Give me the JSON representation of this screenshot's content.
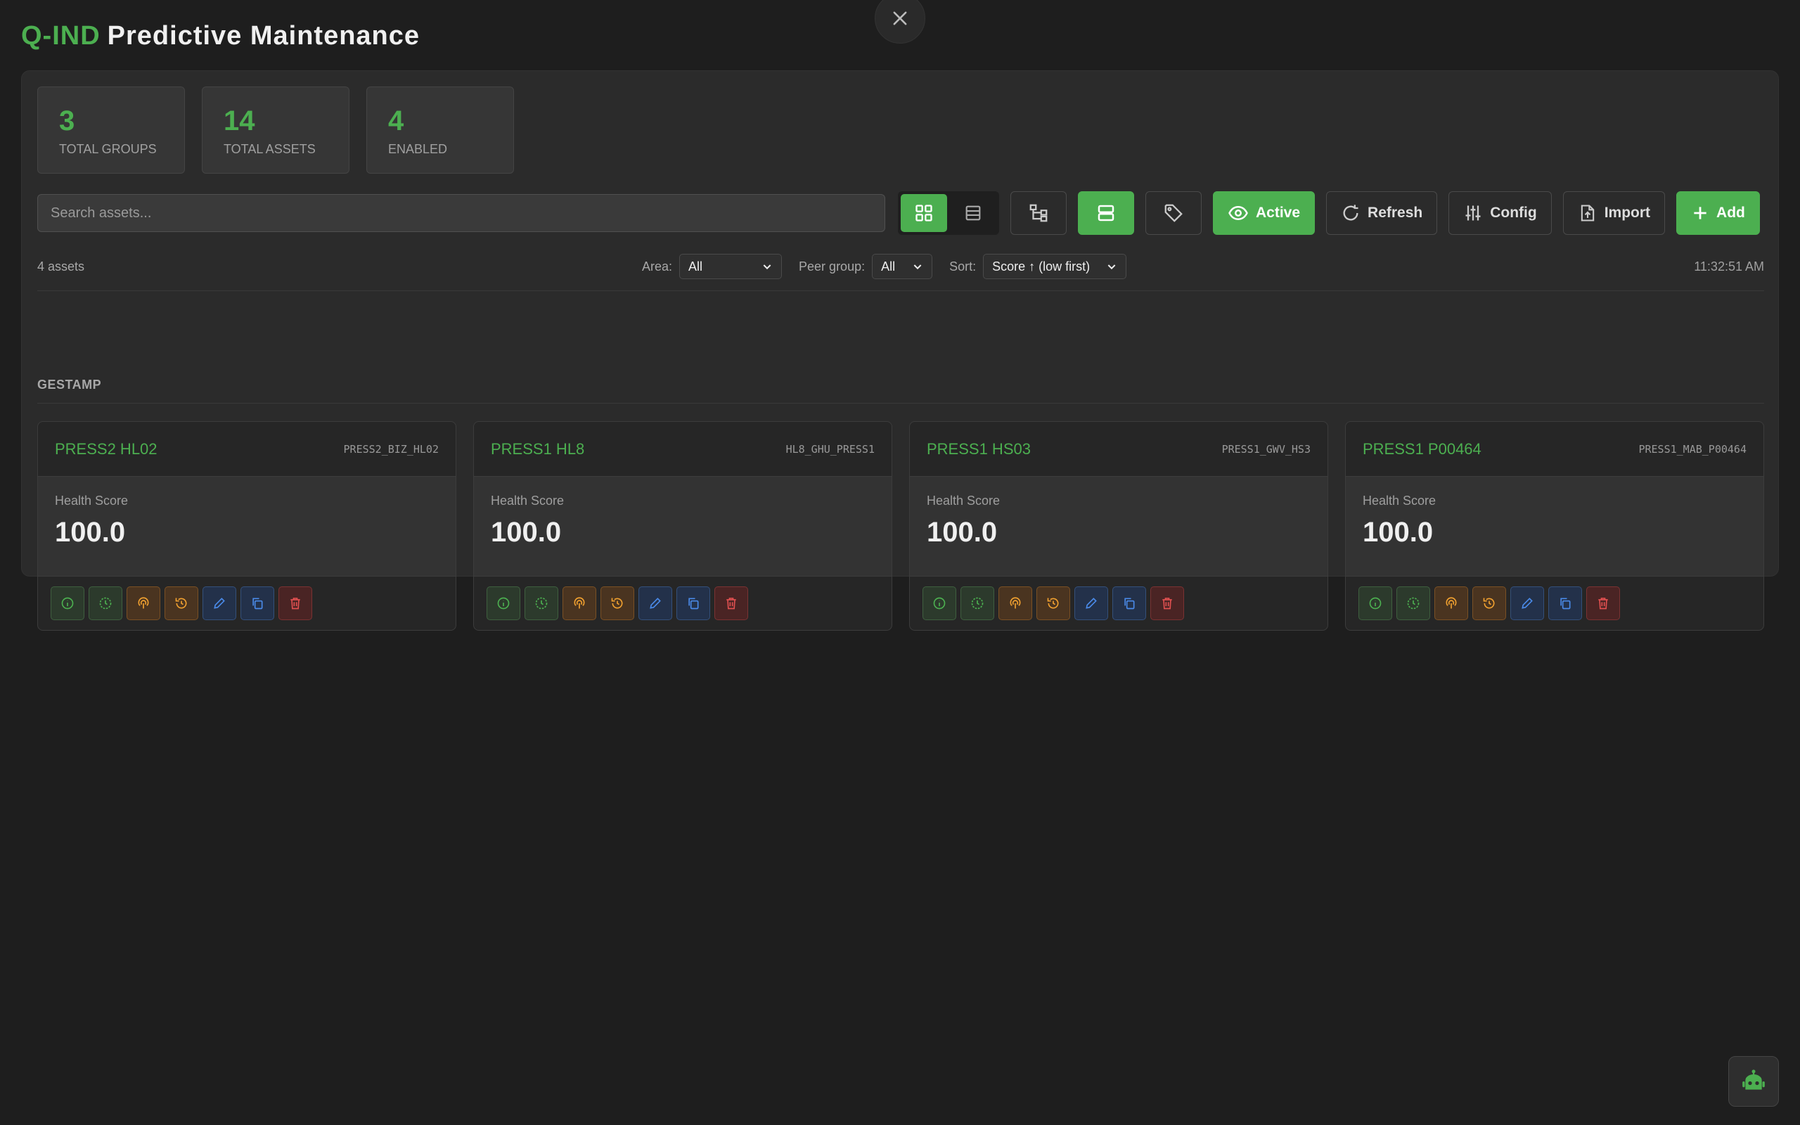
{
  "header": {
    "brand": "Q-IND",
    "title": "Predictive Maintenance"
  },
  "stats": [
    {
      "value": "3",
      "label": "TOTAL GROUPS"
    },
    {
      "value": "14",
      "label": "TOTAL ASSETS"
    },
    {
      "value": "4",
      "label": "ENABLED"
    }
  ],
  "toolbar": {
    "search_placeholder": "Search assets...",
    "active_label": "Active",
    "refresh_label": "Refresh",
    "config_label": "Config",
    "import_label": "Import",
    "add_label": "Add"
  },
  "filters": {
    "count": "4 assets",
    "area_label": "Area:",
    "area_value": "All",
    "peer_label": "Peer group:",
    "peer_value": "All",
    "sort_label": "Sort:",
    "sort_value": "Score ↑ (low first)",
    "time": "11:32:51 AM"
  },
  "group": {
    "name": "GESTAMP",
    "cards": [
      {
        "name": "PRESS2 HL02",
        "code": "PRESS2_BIZ_HL02",
        "score_label": "Health Score",
        "score": "100.0"
      },
      {
        "name": "PRESS1 HL8",
        "code": "HL8_GHU_PRESS1",
        "score_label": "Health Score",
        "score": "100.0"
      },
      {
        "name": "PRESS1 HS03",
        "code": "PRESS1_GWV_HS3",
        "score_label": "Health Score",
        "score": "100.0"
      },
      {
        "name": "PRESS1 P00464",
        "code": "PRESS1_MAB_P00464",
        "score_label": "Health Score",
        "score": "100.0"
      }
    ]
  },
  "colors": {
    "accent": "#4caf50",
    "background": "#1e1e1e",
    "panel": "#2b2b2b",
    "orange": "#f0a030",
    "blue": "#4a8ae8",
    "red": "#e05050"
  },
  "icons": {
    "card_actions": [
      "info-icon",
      "clock-icon",
      "sensor-icon",
      "history-icon",
      "edit-icon",
      "copy-icon",
      "delete-icon"
    ]
  }
}
